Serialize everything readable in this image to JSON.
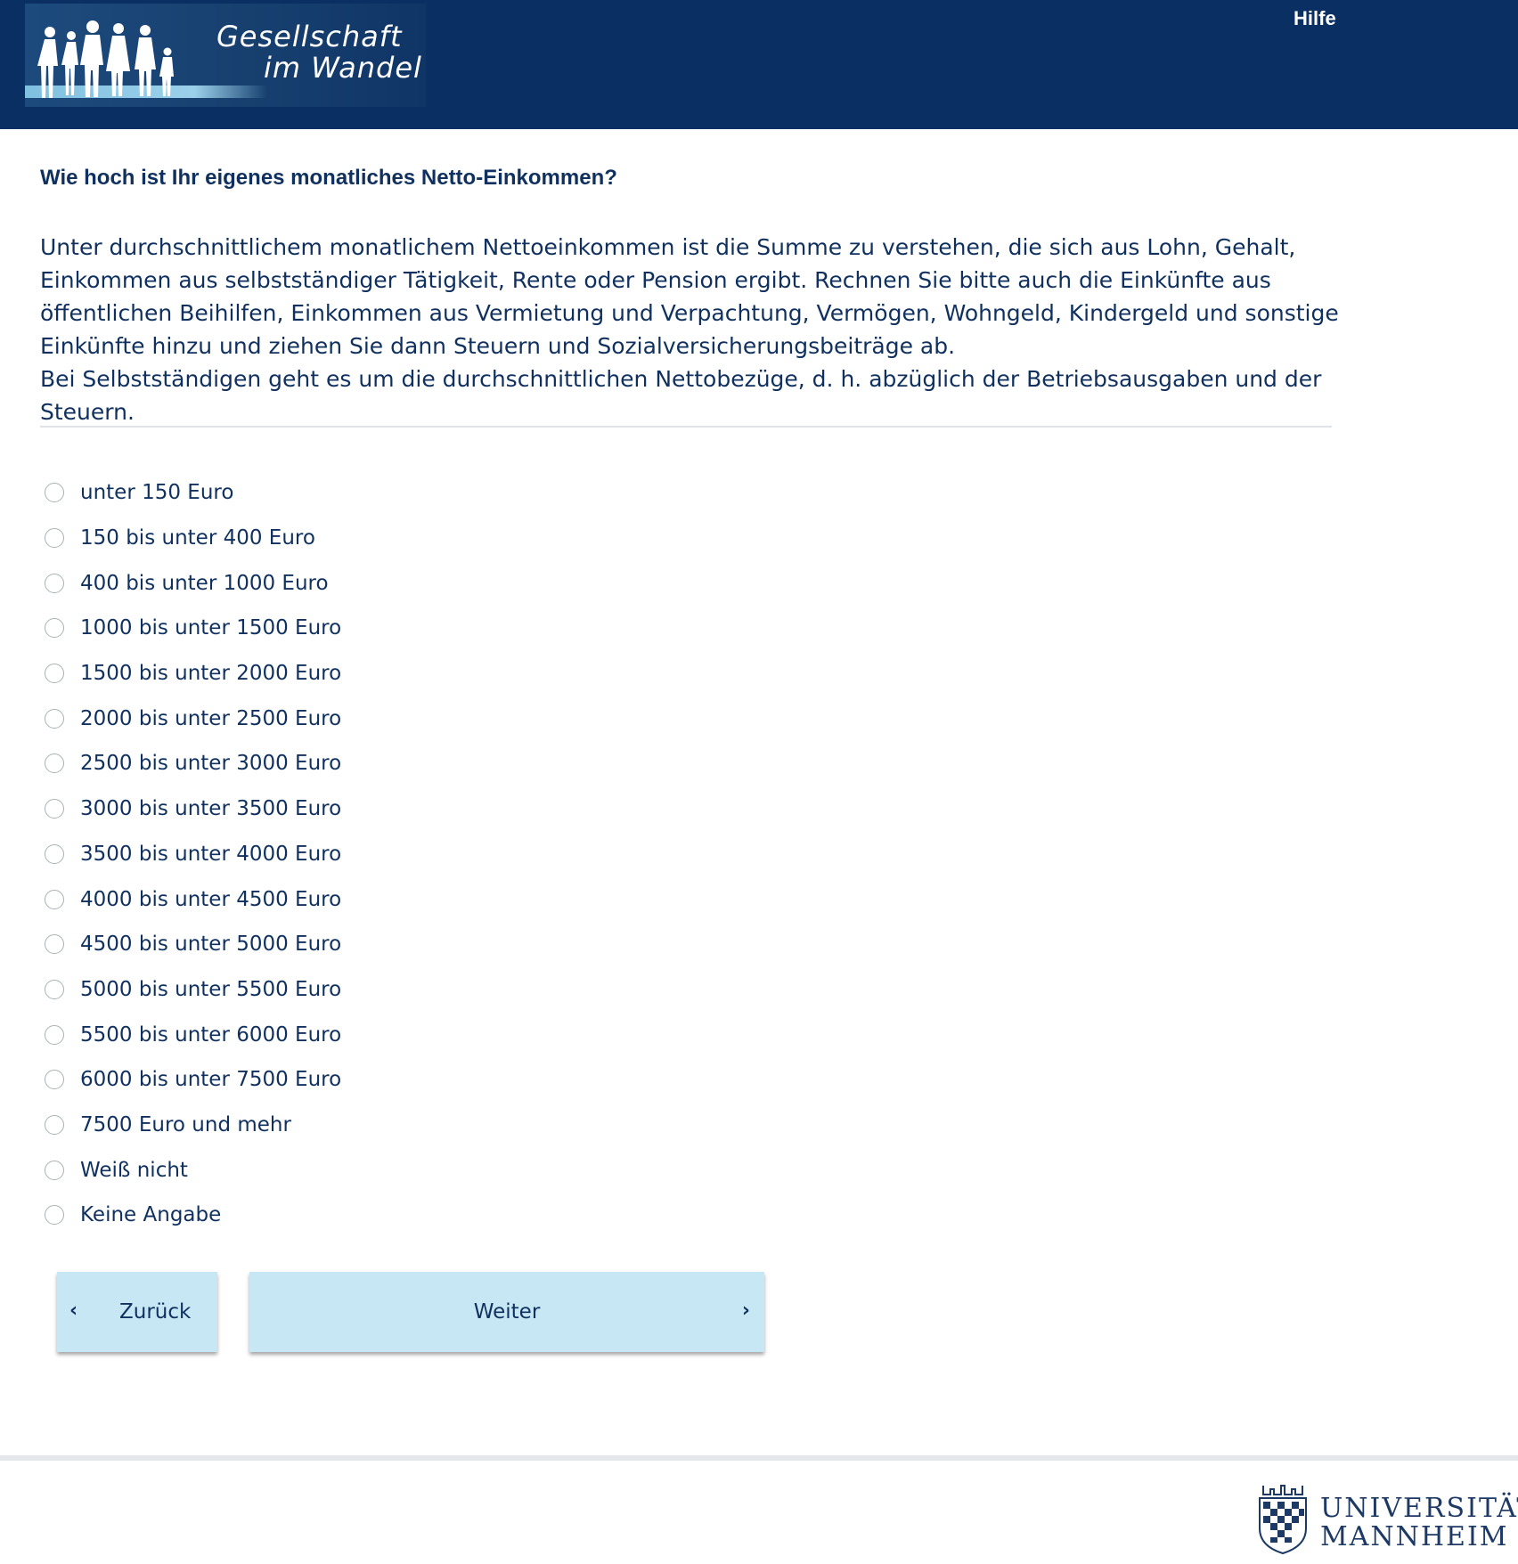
{
  "header": {
    "logo_line1": "Gesellschaft",
    "logo_line2": "im Wandel",
    "help_link": "Hilfe"
  },
  "question": {
    "title": "Wie hoch ist Ihr eigenes monatliches Netto-Einkommen?",
    "explanation_1": "Unter durchschnittlichem monatlichem Nettoeinkommen ist die Summe zu verstehen, die sich aus Lohn, Gehalt, Einkommen aus selbstständiger Tätigkeit, Rente oder Pension ergibt. Rechnen Sie bitte auch die Einkünfte aus öffentlichen Beihilfen, Einkommen aus Vermietung und Verpachtung, Vermögen, Wohngeld, Kindergeld und sonstige Einkünfte hinzu und ziehen Sie dann Steuern und Sozialversicherungsbeiträge ab.",
    "explanation_2": "Bei Selbstständigen geht es um die durchschnittlichen Nettobezüge, d. h. abzüglich der Betriebsausgaben und der Steuern."
  },
  "options": [
    "unter 150 Euro",
    "150 bis unter 400 Euro",
    "400 bis unter 1000 Euro",
    "1000 bis unter 1500 Euro",
    "1500 bis unter 2000 Euro",
    "2000 bis unter 2500 Euro",
    "2500 bis unter 3000 Euro",
    "3000 bis unter 3500 Euro",
    "3500 bis unter 4000 Euro",
    "4000 bis unter 4500 Euro",
    "4500 bis unter 5000 Euro",
    "5000 bis unter 5500 Euro",
    "5500 bis unter 6000 Euro",
    "6000 bis unter 7500 Euro",
    "7500 Euro und mehr",
    "Weiß nicht",
    "Keine Angabe"
  ],
  "buttons": {
    "back_label": "Zurück",
    "next_label": "Weiter",
    "back_icon": "chevron-left-icon",
    "next_icon": "chevron-right-icon"
  },
  "footer": {
    "university_line1": "UNIVERSITÄT",
    "university_line2": "MANNHEIM"
  },
  "colors": {
    "header_bg": "#0a2f63",
    "text": "#10315f",
    "button_bg": "#c6e7f3"
  }
}
